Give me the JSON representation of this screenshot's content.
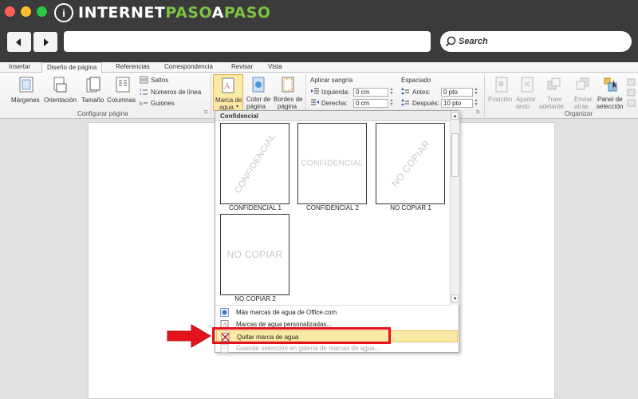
{
  "browser": {
    "brand": {
      "part1": "INTERNET",
      "part2": "PASO",
      "part3": "A",
      "part4": "PASO"
    },
    "search": {
      "placeholder": "Search",
      "icon": "magnifier-icon"
    },
    "colors": {
      "chrome": "#3b3b3b",
      "brand_accent": "#7cc242"
    }
  },
  "ribbon": {
    "tabs": [
      "Insertar",
      "Diseño de página",
      "Referencias",
      "Correspondencia",
      "Revisar",
      "Vista"
    ],
    "active_tab": "Diseño de página",
    "configurar_pagina": {
      "label": "Configurar página",
      "margenes": "Márgenes",
      "orientacion": "Orientación",
      "tamano": "Tamaño",
      "columnas": "Columnas",
      "saltos": "Saltos",
      "numeros_linea": "Números de línea",
      "guiones": "Guiones"
    },
    "fondo_pagina": {
      "marca_line1": "Marca de",
      "marca_line2": "agua",
      "color_line1": "Color de",
      "color_line2": "página",
      "bordes_line1": "Bordes de",
      "bordes_line2": "página"
    },
    "parrafo": {
      "aplicar_sangria": "Aplicar sangría",
      "izquierda_label": "Izquierda:",
      "izquierda_value": "0 cm",
      "derecha_label": "Derecha:",
      "derecha_value": "0 cm",
      "espaciado": "Espaciado",
      "antes_label": "Antes:",
      "antes_value": "0 pto",
      "despues_label": "Después:",
      "despues_value": "10 pto"
    },
    "organizar": {
      "label": "Organizar",
      "posicion": "Posición",
      "ajustar_line1": "Ajustar",
      "ajustar_line2": "texto",
      "traer_line1": "Traer",
      "traer_line2": "adelante",
      "enviar_line1": "Enviar",
      "enviar_line2": "atrás",
      "panel_line1": "Panel de",
      "panel_line2": "selección"
    }
  },
  "watermark_gallery": {
    "header": "Confidencial",
    "items": [
      {
        "caption": "CONFIDENCIAL 1",
        "watermark": "CONFIDENCIAL",
        "style": "diagonal"
      },
      {
        "caption": "CONFIDENCIAL 2",
        "watermark": "CONFIDENCIAL",
        "style": "horizontal"
      },
      {
        "caption": "NO COPIAR 1",
        "watermark": "NO COPIAR",
        "style": "diagonal"
      },
      {
        "caption": "NO COPIAR 2",
        "watermark": "NO COPIAR",
        "style": "horizontal"
      }
    ],
    "menu": [
      {
        "label": "Más marcas de agua de Office.com",
        "icon": "office-online-icon",
        "state": "normal"
      },
      {
        "label": "Marcas de agua personalizadas...",
        "icon": "custom-watermark-icon",
        "state": "normal"
      },
      {
        "label": "Quitar marca de agua",
        "icon": "remove-watermark-icon",
        "state": "highlighted"
      },
      {
        "label": "Guardar selección en galería de marcas de agua...",
        "icon": "save-to-gallery-icon",
        "state": "disabled"
      }
    ]
  },
  "annotation": {
    "color": "#e3131c"
  }
}
